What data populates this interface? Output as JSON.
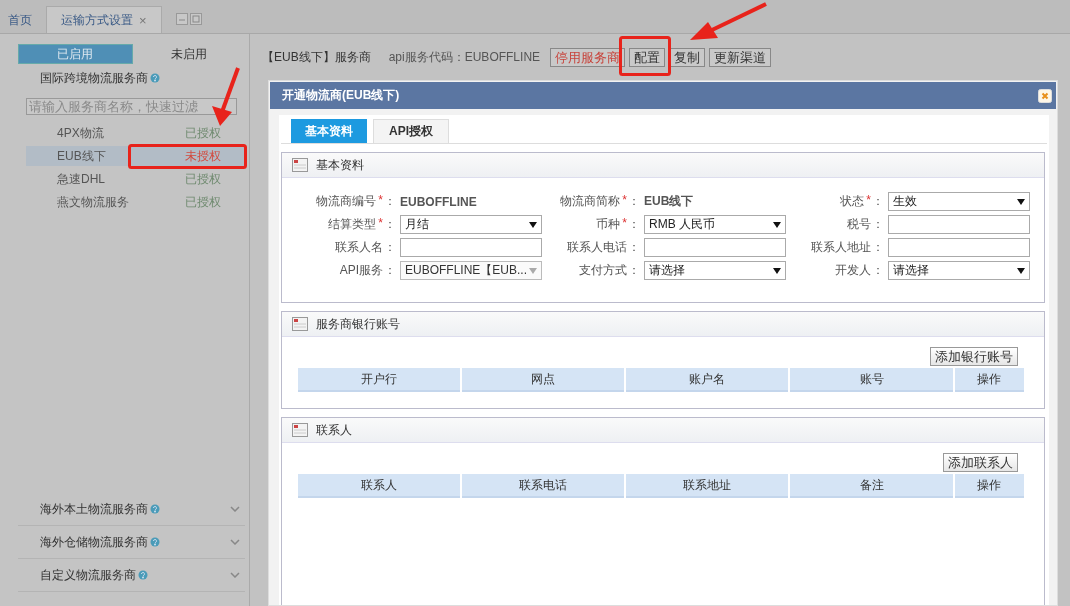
{
  "tabs": [
    {
      "label": "首页",
      "selected": false
    },
    {
      "label": "运输方式设置",
      "selected": true,
      "close": "×"
    }
  ],
  "sidebar": {
    "filters": [
      {
        "label": "已启用",
        "selected": true
      },
      {
        "label": "未启用",
        "selected": false
      }
    ],
    "groups": [
      {
        "title": "国际跨境物流服务商",
        "expanded": true,
        "placeholder": "请输入服务商名称，快速过滤",
        "items": [
          {
            "name": "4PX物流",
            "status": "已授权",
            "authorized": true,
            "selected": false
          },
          {
            "name": "EUB线下",
            "status": "未授权",
            "authorized": false,
            "selected": true
          },
          {
            "name": "急速DHL",
            "status": "已授权",
            "authorized": true,
            "selected": false
          },
          {
            "name": "燕文物流服务",
            "status": "已授权",
            "authorized": true,
            "selected": false
          }
        ]
      },
      {
        "title": "海外本土物流服务商",
        "expanded": false
      },
      {
        "title": "海外仓储物流服务商",
        "expanded": false
      },
      {
        "title": "自定义物流服务商",
        "expanded": false
      }
    ]
  },
  "toolbar": {
    "title": "【EUB线下】服务商",
    "api_code": "api服务代码：EUBOFFLINE",
    "buttons": [
      {
        "label": "停用服务商",
        "kind": "danger"
      },
      {
        "label": "配置",
        "kind": "normal"
      },
      {
        "label": "复制",
        "kind": "normal"
      },
      {
        "label": "更新渠道",
        "kind": "normal"
      }
    ]
  },
  "modal": {
    "title": "开通物流商(EUB线下)",
    "tabs": [
      {
        "label": "基本资料",
        "selected": true
      },
      {
        "label": "API授权",
        "selected": false
      }
    ],
    "sections": [
      {
        "kind": "form",
        "title": "基本资料",
        "fields": [
          {
            "label": "物流商编号",
            "mark": "*",
            "colon": "：",
            "kind": "static",
            "value": "EUBOFFLINE"
          },
          {
            "label": "物流商简称",
            "mark": "*",
            "colon": "：",
            "kind": "static",
            "value": "EUB线下"
          },
          {
            "label": "状态",
            "mark": "*",
            "colon": "：",
            "kind": "select",
            "value": "生效"
          },
          {
            "label": "结算类型",
            "mark": "*",
            "colon": "：",
            "kind": "select",
            "value": "月结"
          },
          {
            "label": "币种",
            "mark": "*",
            "colon": "：",
            "kind": "select",
            "value": "RMB 人民币"
          },
          {
            "label": "税号",
            "colon": "：",
            "kind": "input"
          },
          {
            "label": "联系人名",
            "colon": "：",
            "kind": "input"
          },
          {
            "label": "联系人电话",
            "colon": "：",
            "kind": "input"
          },
          {
            "label": "联系人地址",
            "colon": "：",
            "kind": "input"
          },
          {
            "label": "API服务",
            "colon": "：",
            "kind": "combo",
            "value": "EUBOFFLINE【EUB..."
          },
          {
            "label": "支付方式",
            "colon": "：",
            "kind": "select",
            "value": "请选择"
          },
          {
            "label": "开发人",
            "colon": "：",
            "kind": "select",
            "value": "请选择"
          }
        ]
      },
      {
        "kind": "table",
        "title": "服务商银行账号",
        "button": "添加银行账号",
        "columns": [
          "开户行",
          "网点",
          "账户名",
          "账号",
          "操作"
        ]
      },
      {
        "kind": "table",
        "title": "联系人",
        "button": "添加联系人",
        "columns": [
          "联系人",
          "联系电话",
          "联系地址",
          "备注",
          "操作"
        ]
      }
    ]
  }
}
